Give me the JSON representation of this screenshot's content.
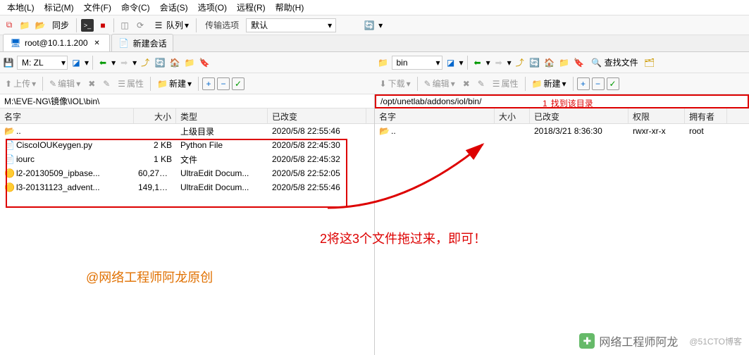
{
  "menu": {
    "local": "本地(L)",
    "mark": "标记(M)",
    "file": "文件(F)",
    "cmd": "命令(C)",
    "session": "会话(S)",
    "options": "选项(O)",
    "remote": "远程(R)",
    "help": "帮助(H)"
  },
  "toolbar": {
    "sync": "同步",
    "queue": "队列",
    "transfer_label": "传输选项",
    "transfer_value": "默认"
  },
  "tabs": {
    "t1": "root@10.1.1.200",
    "t2": "新建会话"
  },
  "nav": {
    "drive": "M: ZL",
    "remote_dir": "bin",
    "find": "查找文件"
  },
  "actions": {
    "upload": "上传",
    "download": "下载",
    "edit": "编辑",
    "props": "属性",
    "new": "新建"
  },
  "left": {
    "path": "M:\\EVE-NG\\镜像\\IOL\\bin\\",
    "cols": {
      "name": "名字",
      "size": "大小",
      "type": "类型",
      "changed": "已改变"
    },
    "parent": {
      "name": "..",
      "type": "上级目录",
      "changed": "2020/5/8  22:55:46"
    },
    "rows": [
      {
        "name": "CiscoIOUKeygen.py",
        "size": "2 KB",
        "type": "Python File",
        "changed": "2020/5/8  22:45:30",
        "icon": "py"
      },
      {
        "name": "iourc",
        "size": "1 KB",
        "type": "文件",
        "changed": "2020/5/8  22:45:32",
        "icon": "file"
      },
      {
        "name": "l2-20130509_ipbase...",
        "size": "60,277 ...",
        "type": "UltraEdit Docum...",
        "changed": "2020/5/8  22:52:05",
        "icon": "ue"
      },
      {
        "name": "l3-20131123_advent...",
        "size": "149,100...",
        "type": "UltraEdit Docum...",
        "changed": "2020/5/8  22:55:46",
        "icon": "ue"
      }
    ]
  },
  "right": {
    "path": "/opt/unetlab/addons/iol/bin/",
    "cols": {
      "name": "名字",
      "size": "大小",
      "changed": "已改变",
      "perm": "权限",
      "owner": "拥有者"
    },
    "parent": {
      "name": "..",
      "changed": "2018/3/21 8:36:30",
      "perm": "rwxr-xr-x",
      "owner": "root"
    }
  },
  "anno": {
    "n1": "1",
    "t1": "找到该目录",
    "t2": "2将这3个文件拖过来，即可！",
    "t3": "@网络工程师阿龙原创"
  },
  "watermark": {
    "name": "网络工程师阿龙",
    "site": "@51CTO博客"
  }
}
